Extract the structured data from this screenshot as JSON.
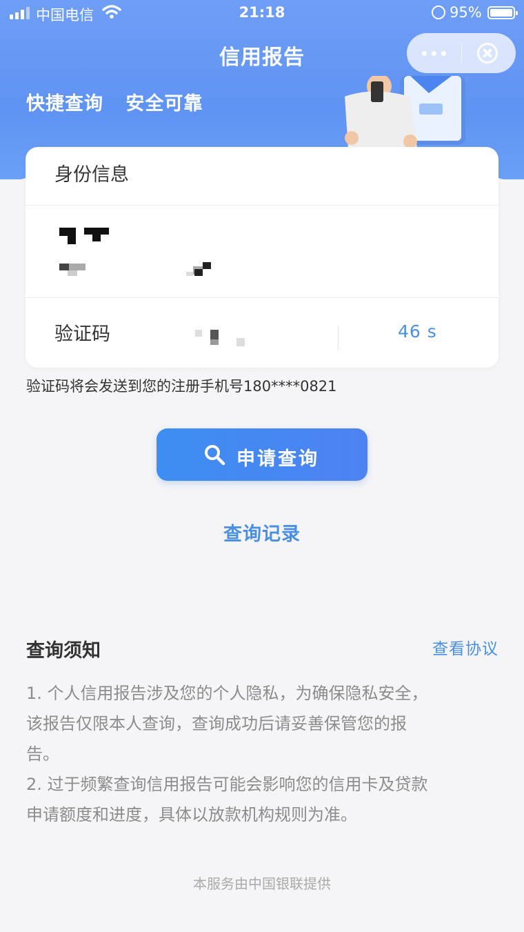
{
  "status_bar": {
    "carrier": "中国电信",
    "time": "21:18",
    "battery": "95%"
  },
  "nav": {
    "title": "信用报告"
  },
  "hero": {
    "slogan_1": "快捷查询",
    "slogan_2": "安全可靠"
  },
  "card": {
    "header": "身份信息",
    "code_label": "验证码",
    "countdown": "46 s"
  },
  "hint": "验证码将会发送到您的注册手机号180****0821",
  "apply_button": "申请查询",
  "records_link": "查询记录",
  "notice": {
    "title": "查询须知",
    "agreement_link": "查看协议",
    "line_1": "1. 个人信用报告涉及您的个人隐私，为确保隐私安全，",
    "line_2": "该报告仅限本人查询，查询成功后请妥善保管您的报",
    "line_3": "告。",
    "line_4": "2. 过于频繁查询信用报告可能会影响您的信用卡及贷款",
    "line_5": "申请额度和进度，具体以放款机构规则为准。"
  },
  "footer": "本服务由中国银联提供",
  "colors": {
    "accent": "#4a8fe0",
    "header_blue": "#6f9ef6",
    "button_blue": "#3d8ef2"
  }
}
